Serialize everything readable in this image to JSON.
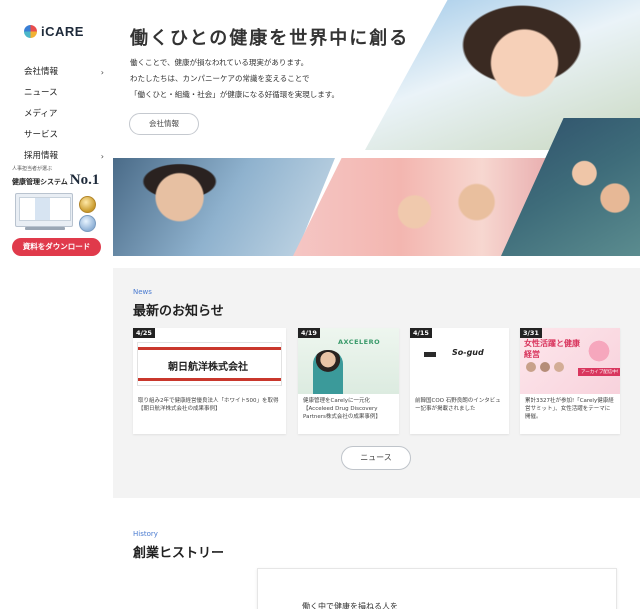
{
  "brand": {
    "name": "iCARE"
  },
  "sidebar": {
    "items": [
      {
        "label": "会社情報",
        "chevron": true
      },
      {
        "label": "ニュース",
        "chevron": false
      },
      {
        "label": "メディア",
        "chevron": false
      },
      {
        "label": "サービス",
        "chevron": false
      },
      {
        "label": "採用情報",
        "chevron": true
      }
    ],
    "badge": {
      "small": "人事担当者が選ぶ",
      "title": "健康管理システム",
      "rank": "No.1"
    },
    "download_label": "資料をダウンロード"
  },
  "hero": {
    "title": "働くひとの健康を世界中に創る",
    "lines": [
      "働くことで、健康が損なわれている現実があります。",
      "わたしたちは、カンパニーケアの常識を変えることで",
      "「働くひと・組織・社会」が健康になる好循環を実現します。"
    ],
    "button_label": "会社情報"
  },
  "news": {
    "eyebrow": "News",
    "title": "最新のお知らせ",
    "cards": [
      {
        "date": "4/25",
        "thumb_text": "朝日航洋株式会社",
        "caption": "取り組み2年で健康経営優良法人「ホワイト500」を取得【朝日航洋株式会社の成果事例】"
      },
      {
        "date": "4/19",
        "thumb_text": "AXCELERO",
        "caption": "健康管理をCarelyに一元化【Acceleed Drug Discovery Partners株式会社の成果事例】"
      },
      {
        "date": "4/15",
        "thumb_text": "So-gud",
        "caption": "前韓国COO 石野良朗のインタビュー記事が掲載されました"
      },
      {
        "date": "3/31",
        "thumb_text": "女性活躍と健康経営",
        "thumb_sub": "アーカイブ配信中!",
        "caption": "累計3327社が参加!「Carely健康経営サミット」、女性活躍をテーマに開催。"
      }
    ],
    "more_label": "ニュース"
  },
  "history": {
    "eyebrow": "History",
    "title": "創業ヒストリー",
    "box_text": "働く中で健康を損ねる人を"
  }
}
